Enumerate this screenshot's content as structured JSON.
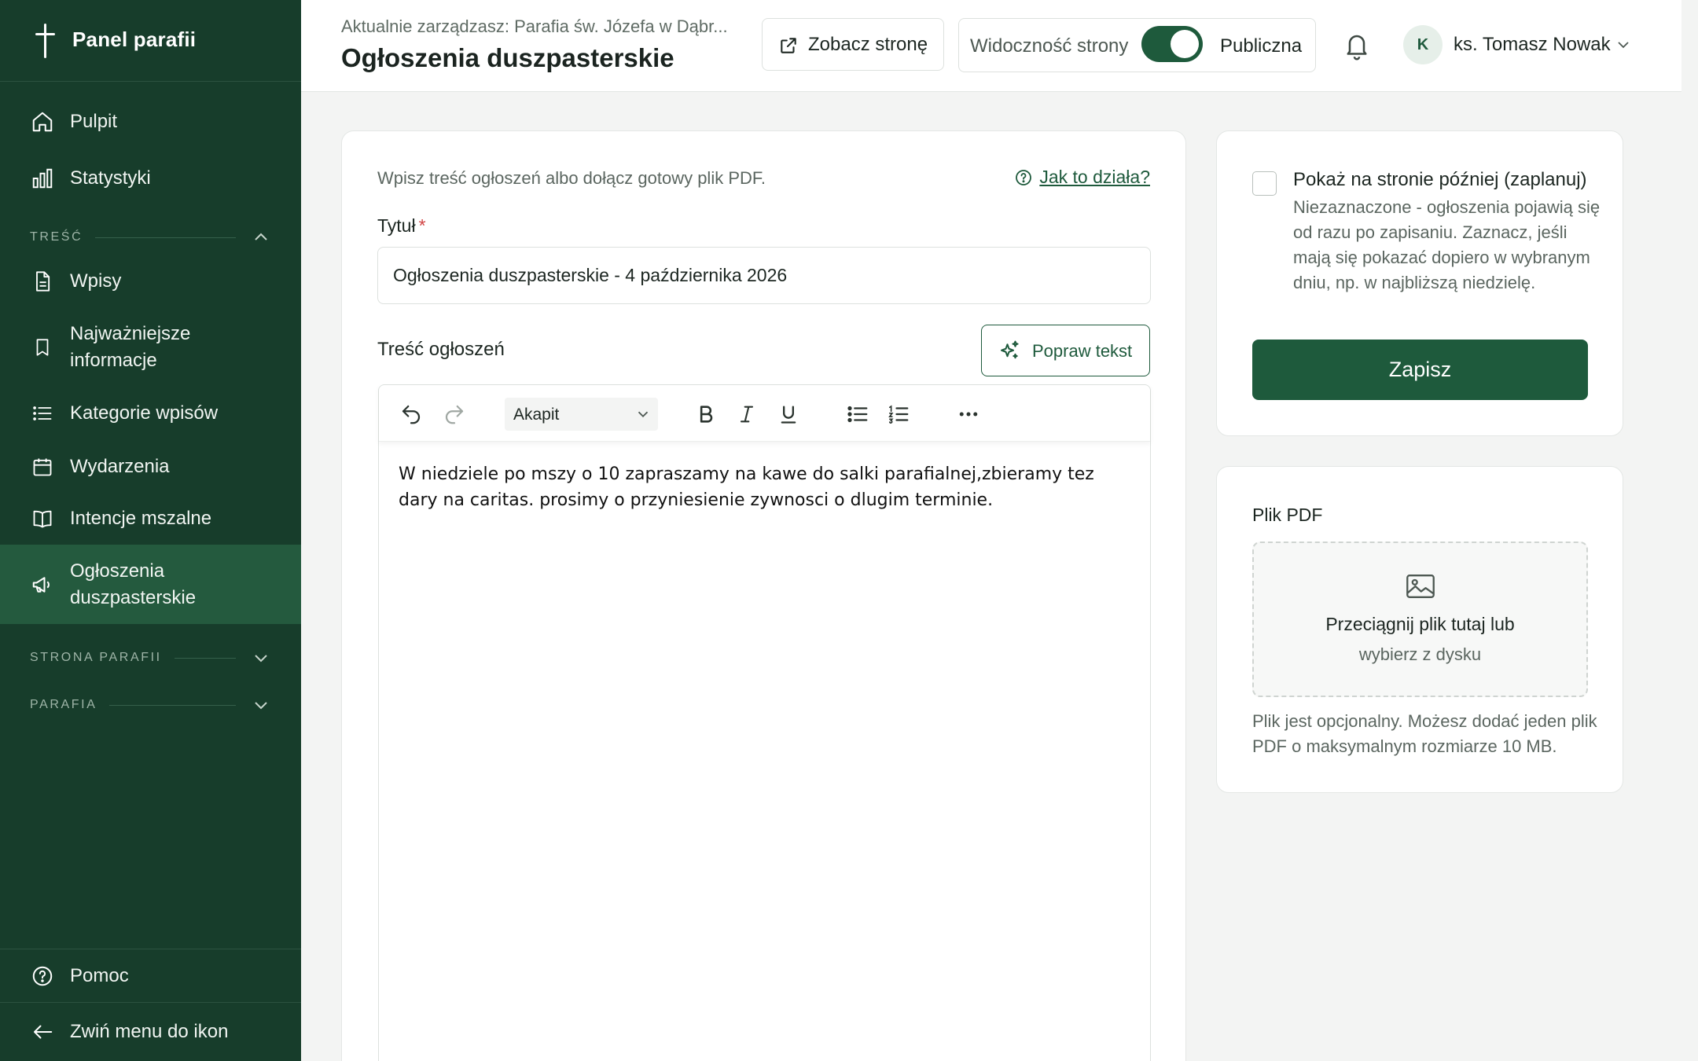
{
  "sidebar": {
    "brand": "Panel parafii",
    "items": [
      {
        "label": "Pulpit",
        "icon": "home-icon"
      },
      {
        "label": "Statystyki",
        "icon": "bar-chart-icon"
      }
    ],
    "section_content": {
      "title": "TREŚĆ",
      "items": [
        {
          "label": "Wpisy",
          "icon": "document-icon"
        },
        {
          "label": "Najważniejsze informacje",
          "icon": "bookmark-icon"
        },
        {
          "label": "Kategorie wpisów",
          "icon": "list-icon"
        },
        {
          "label": "Wydarzenia",
          "icon": "calendar-icon"
        },
        {
          "label": "Intencje mszalne",
          "icon": "book-icon"
        },
        {
          "label": "Ogłoszenia duszpasterskie",
          "icon": "megaphone-icon",
          "active": true
        }
      ]
    },
    "section_site": {
      "title": "STRONA PARAFII"
    },
    "section_parish": {
      "title": "PARAFIA"
    },
    "help": "Pomoc",
    "collapse": "Zwiń menu do ikon"
  },
  "header": {
    "context": "Aktualnie zarządzasz: Parafia św. Józefa w Dąbr...",
    "title": "Ogłoszenia duszpasterskie",
    "view_site": "Zobacz stronę",
    "visibility_label": "Widoczność strony",
    "visibility_state": "Publiczna",
    "user_initial": "K",
    "user_name": "ks. Tomasz Nowak"
  },
  "form": {
    "intro": "Wpisz treść ogłoszeń albo dołącz gotowy plik PDF.",
    "help_link": "Jak to działa?",
    "title_label": "Tytuł",
    "required_mark": "*",
    "title_value": "Ogłoszenia duszpasterskie - 4 października 2026",
    "content_label": "Treść ogłoszeń",
    "improve_button": "Popraw tekst",
    "paragraph_select": "Akapit",
    "content_text": "W niedziele po mszy o 10 zapraszamy na kawe do salki parafialnej,zbieramy tez dary na caritas. prosimy o przyniesienie zywnosci o dlugim terminie."
  },
  "schedule": {
    "title": "Pokaż na stronie później (zaplanuj)",
    "description": "Niezaznaczone - ogłoszenia pojawią się od razu po zapisaniu. Zaznacz, jeśli mają się pokazać dopiero w wybranym dniu, np. w najbliższą niedzielę.",
    "checked": false,
    "save": "Zapisz"
  },
  "pdf": {
    "title": "Plik PDF",
    "drop_line1": "Przeciągnij plik tutaj lub",
    "drop_line2": "wybierz z dysku",
    "note": "Plik jest opcjonalny. Możesz dodać jeden plik PDF o maksymalnym rozmiarze 10 MB."
  },
  "colors": {
    "sidebar_bg": "#173d2b",
    "sidebar_active": "#245a3e",
    "accent": "#1e5a3c",
    "required": "#d14343"
  }
}
